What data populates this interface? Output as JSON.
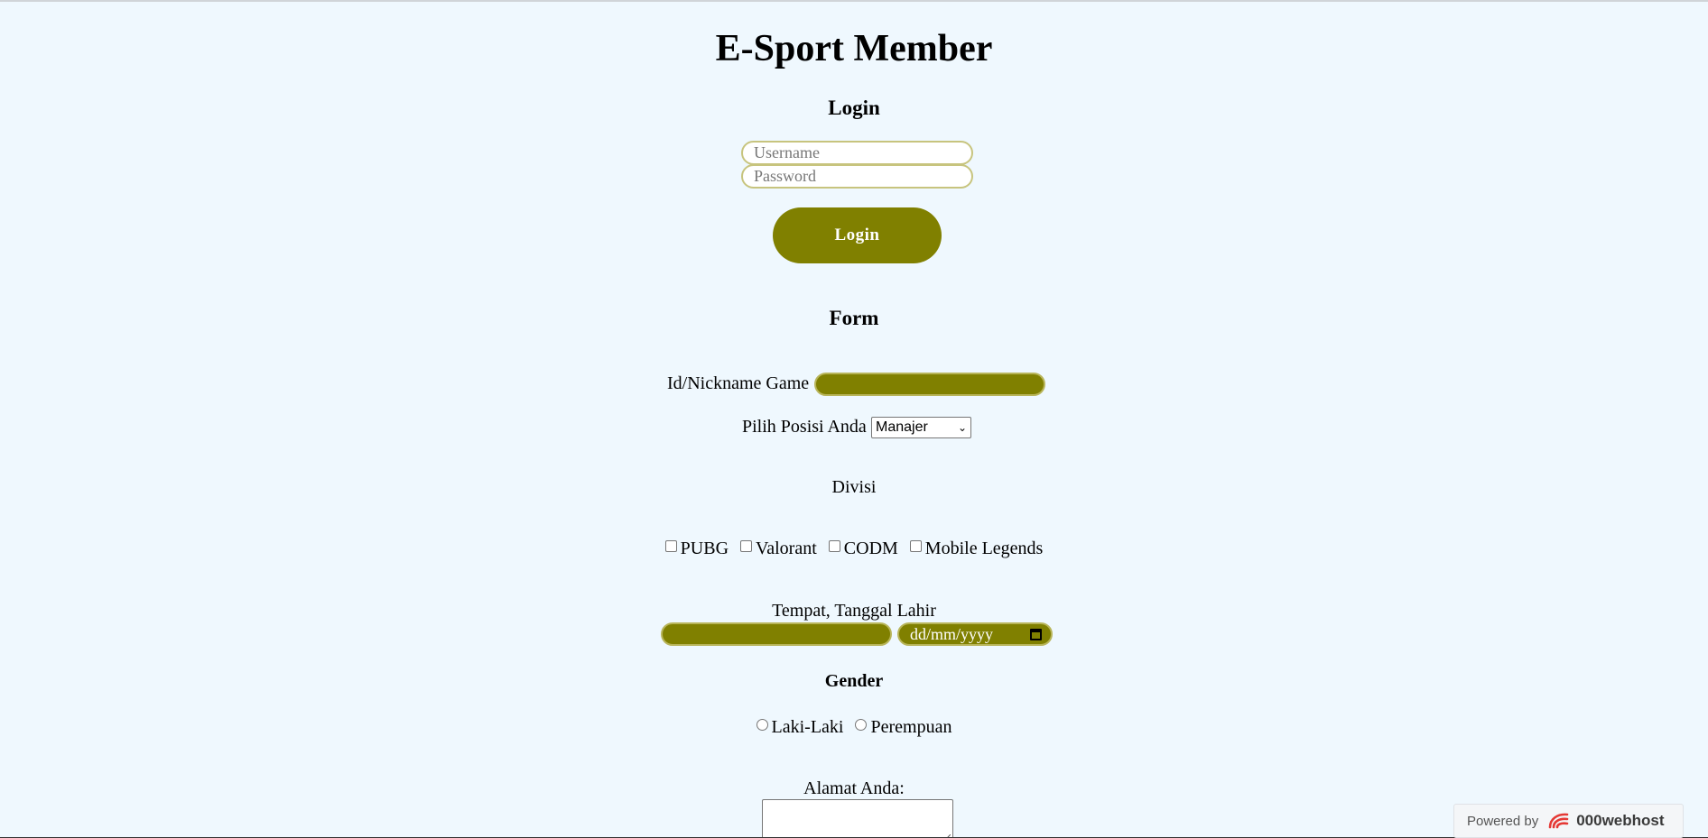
{
  "header": {
    "title": "E-Sport Member"
  },
  "login": {
    "heading": "Login",
    "username_placeholder": "Username",
    "password_placeholder": "Password",
    "button_label": "Login"
  },
  "form": {
    "heading": "Form",
    "nickname_label": "Id/Nickname Game",
    "position_label": "Pilih Posisi Anda",
    "position_selected": "Manajer",
    "division_label": "Divisi",
    "divisions": [
      "PUBG",
      "Valorant",
      "CODM",
      "Mobile Legends"
    ],
    "birth_label": "Tempat, Tanggal Lahir",
    "date_placeholder": "dd/mm/yyyy",
    "gender_heading": "Gender",
    "genders": [
      "Laki-Laki",
      "Perempuan"
    ],
    "address_label": "Alamat Anda:"
  },
  "badge": {
    "powered_by": "Powered by",
    "brand": "000webhost",
    "logo_icon": "000webhost-logo-icon"
  },
  "colors": {
    "background": "#eff8fe",
    "accent_olive": "#808000",
    "input_border": "#c7c47e"
  }
}
